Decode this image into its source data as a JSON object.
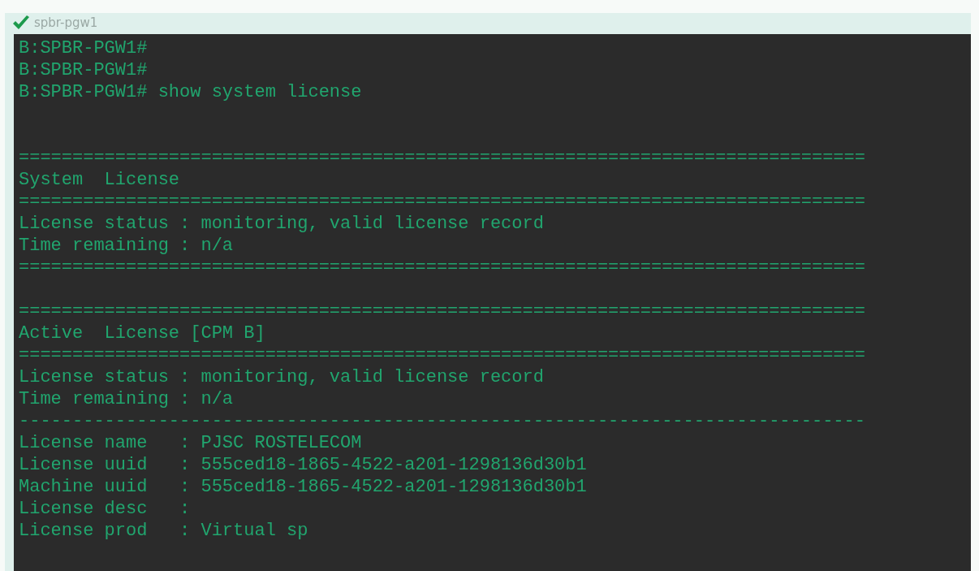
{
  "window": {
    "title": "spbr-pgw1"
  },
  "terminal": {
    "lines": [
      {
        "kind": "text",
        "text": "B:SPBR-PGW1#"
      },
      {
        "kind": "text",
        "text": "B:SPBR-PGW1#"
      },
      {
        "kind": "text",
        "text": "B:SPBR-PGW1# show system license"
      },
      {
        "kind": "blank"
      },
      {
        "kind": "blank"
      },
      {
        "kind": "rule",
        "text": "==============================================================================="
      },
      {
        "kind": "text",
        "text": "System  License"
      },
      {
        "kind": "rule",
        "text": "==============================================================================="
      },
      {
        "kind": "text",
        "text": "License status : monitoring, valid license record"
      },
      {
        "kind": "text",
        "text": "Time remaining : n/a"
      },
      {
        "kind": "rule",
        "text": "==============================================================================="
      },
      {
        "kind": "blank"
      },
      {
        "kind": "rule",
        "text": "==============================================================================="
      },
      {
        "kind": "text",
        "text": "Active  License [CPM B]"
      },
      {
        "kind": "rule",
        "text": "==============================================================================="
      },
      {
        "kind": "text",
        "text": "License status : monitoring, valid license record"
      },
      {
        "kind": "text",
        "text": "Time remaining : n/a"
      },
      {
        "kind": "rule",
        "text": "-------------------------------------------------------------------------------"
      },
      {
        "kind": "text",
        "text": "License name   : PJSC ROSTELECOM"
      },
      {
        "kind": "text",
        "text": "License uuid   : 555ced18-1865-4522-a201-1298136d30b1"
      },
      {
        "kind": "text",
        "text": "Machine uuid   : 555ced18-1865-4522-a201-1298136d30b1"
      },
      {
        "kind": "text",
        "text": "License desc   :"
      },
      {
        "kind": "text",
        "text": "License prod   : Virtual sp"
      }
    ]
  }
}
